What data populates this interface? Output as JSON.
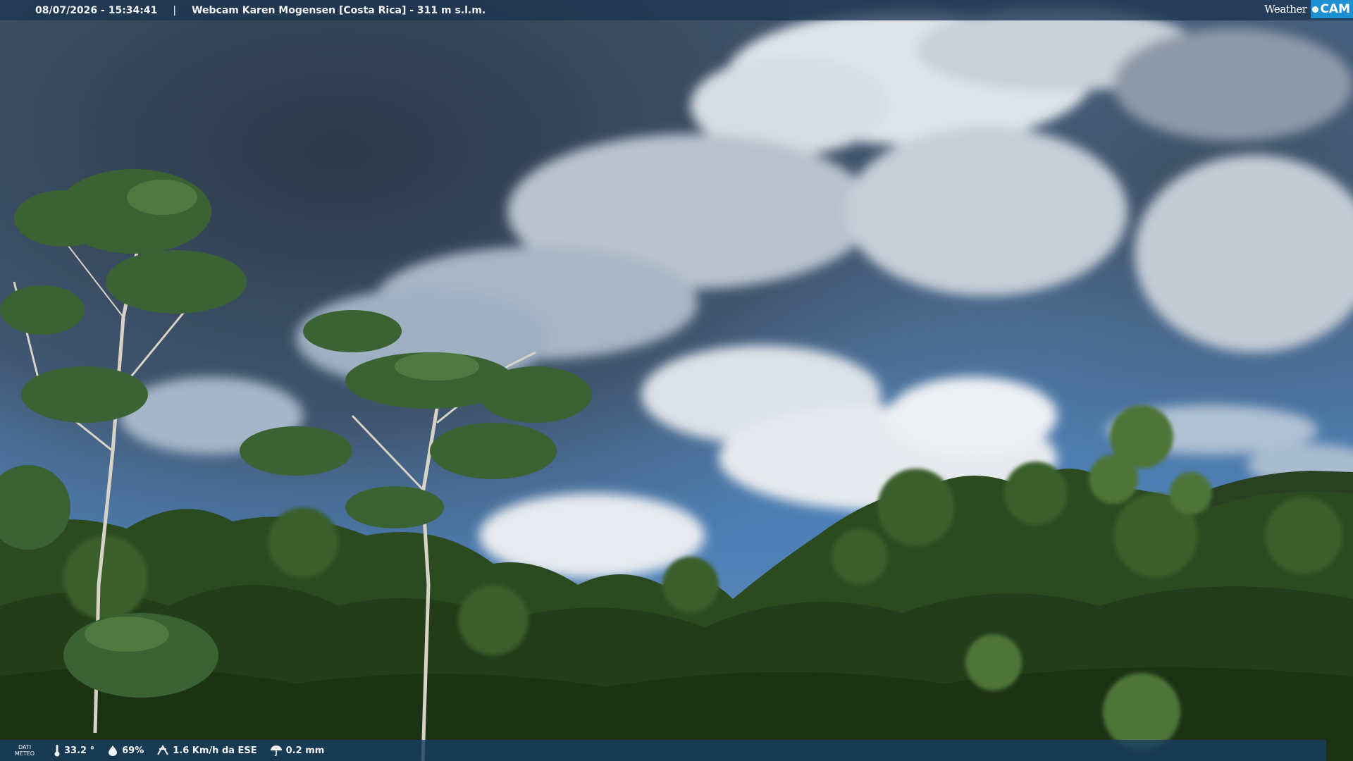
{
  "header": {
    "datetime": "08/07/2026 - 15:34:41",
    "separator": "|",
    "location": "Webcam Karen Mogensen [Costa Rica]  - 311 m s.l.m."
  },
  "logo": {
    "word_weather": "Weather",
    "word_cam": "CAM"
  },
  "footer": {
    "dati_line1": "DATI",
    "dati_line2": "METEO",
    "temperature": "33.2 °",
    "humidity": "69%",
    "wind": "1.6 Km/h da ESE",
    "rain": "0.2 mm"
  },
  "colors": {
    "sky": "#5a87b5",
    "forest": "#2e4d22",
    "header_bar": "#1c3450",
    "footer_bar": "#183c62",
    "logo_accent": "#1e8fd0"
  }
}
